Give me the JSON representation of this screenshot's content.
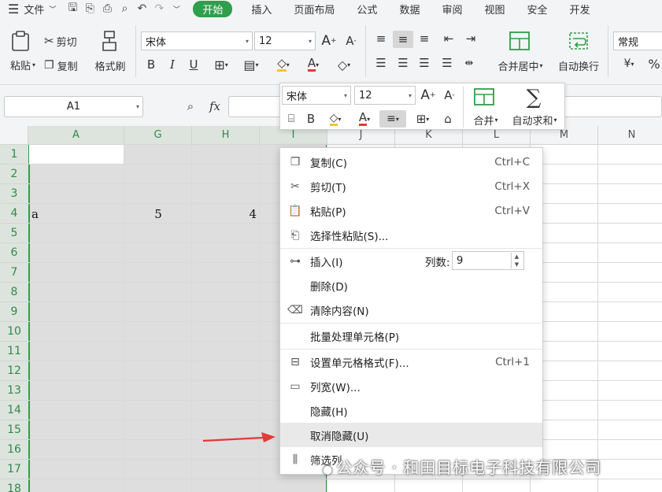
{
  "menubar": {
    "items": [
      "文件",
      "开始",
      "插入",
      "页面布局",
      "公式",
      "数据",
      "审阅",
      "视图",
      "安全",
      "开发"
    ],
    "active": "开始"
  },
  "ribbon": {
    "paste": "粘贴",
    "cut": "剪切",
    "copy": "复制",
    "format_painter": "格式刷",
    "font_name": "宋体",
    "font_size": "12",
    "bold": "B",
    "italic": "I",
    "underline": "U",
    "merge_center": "合并居中",
    "wrap_text": "自动换行",
    "number_format": "常规"
  },
  "formula_bar": {
    "name_box": "A1",
    "fx": "fx"
  },
  "grid": {
    "columns": [
      "A",
      "G",
      "H",
      "I",
      "J",
      "K",
      "L",
      "M",
      "N"
    ],
    "rows": [
      "1",
      "2",
      "3",
      "4",
      "5",
      "6",
      "7",
      "8",
      "9",
      "10",
      "11",
      "12",
      "13",
      "14",
      "15",
      "16",
      "17",
      "18"
    ],
    "cells": {
      "a4": "a",
      "g4": "5",
      "h4": "4"
    }
  },
  "mini_toolbar": {
    "font_name": "宋体",
    "font_size": "12",
    "bold": "B",
    "merge": "合并",
    "autosum": "自动求和"
  },
  "context_menu": {
    "items": [
      {
        "label": "复制(C)",
        "shortcut": "Ctrl+C"
      },
      {
        "label": "剪切(T)",
        "shortcut": "Ctrl+X"
      },
      {
        "label": "粘贴(P)",
        "shortcut": "Ctrl+V"
      },
      {
        "label": "选择性粘贴(S)...",
        "shortcut": ""
      },
      {
        "label": "插入(I)",
        "shortcut": ""
      },
      {
        "label": "删除(D)",
        "shortcut": ""
      },
      {
        "label": "清除内容(N)",
        "shortcut": ""
      },
      {
        "label": "批量处理单元格(P)",
        "shortcut": ""
      },
      {
        "label": "设置单元格格式(F)...",
        "shortcut": "Ctrl+1"
      },
      {
        "label": "列宽(W)...",
        "shortcut": ""
      },
      {
        "label": "隐藏(H)",
        "shortcut": ""
      },
      {
        "label": "取消隐藏(U)",
        "shortcut": ""
      },
      {
        "label": "筛选列",
        "shortcut": ""
      }
    ],
    "insert_count_label": "列数:",
    "insert_count_value": "9",
    "highlighted": "取消隐藏(U)"
  },
  "watermark": "公众号 · 和田目标电子科技有限公司",
  "colors": {
    "accent_green": "#2e9f4a",
    "selection_fill": "#dde4de",
    "arrow_red": "#e53935"
  }
}
